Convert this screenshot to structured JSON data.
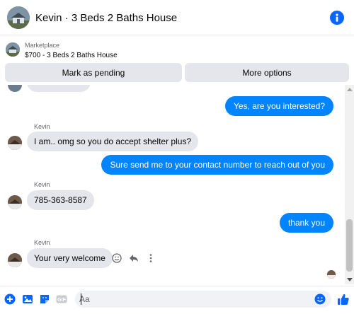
{
  "header": {
    "title": "Kevin · 3 Beds 2 Baths House",
    "avatar_icon": "house-photo-avatar",
    "info_icon": "info-icon"
  },
  "marketplace": {
    "label": "Marketplace",
    "item": "$700 - 3 Beds 2 Baths House",
    "thumb_icon": "house-photo-thumb"
  },
  "actions": {
    "pending_label": "Mark as pending",
    "more_label": "More options"
  },
  "messages": [
    {
      "from": "me",
      "text": "Yes, are you interested?"
    },
    {
      "from": "Kevin",
      "sender": "Kevin",
      "text": "I am.. omg so you do accept shelter plus?"
    },
    {
      "from": "me",
      "text": "Sure send me to your contact number to reach out of you"
    },
    {
      "from": "Kevin",
      "sender": "Kevin",
      "text": "785-363-8587"
    },
    {
      "from": "me",
      "text": "thank you"
    },
    {
      "from": "Kevin",
      "sender": "Kevin",
      "text": "Your very welcome"
    }
  ],
  "message_actions": [
    "react-smile-icon",
    "reply-icon",
    "more-dots-icon"
  ],
  "composer": {
    "placeholder": "Aa",
    "icons": [
      "add-circle-icon",
      "photo-icon",
      "sticker-icon",
      "gif-icon",
      "emoji-icon",
      "like-thumb-icon"
    ]
  },
  "colors": {
    "accent": "#0084ff",
    "bubble_in": "#e4e6eb",
    "brand_blue": "#0866ff"
  }
}
